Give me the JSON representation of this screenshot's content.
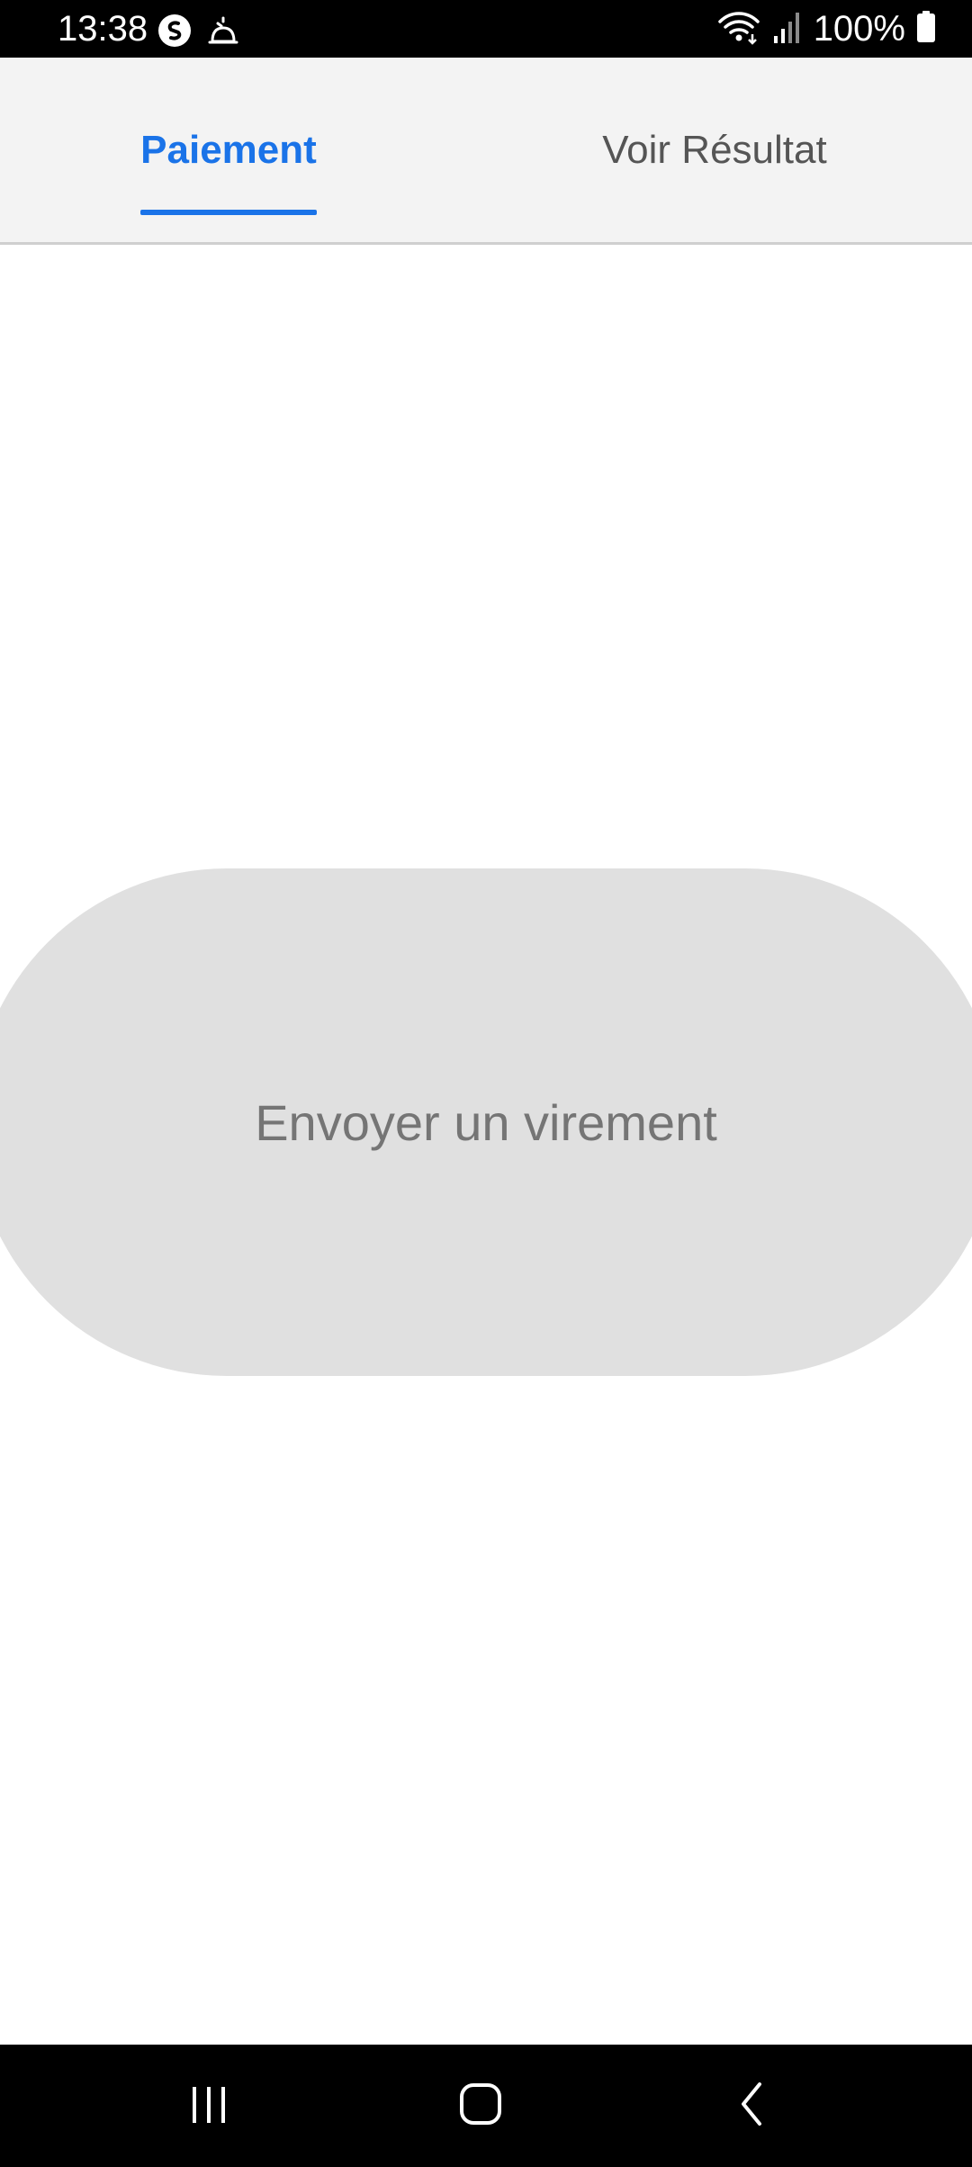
{
  "status_bar": {
    "time": "13:38",
    "battery_percent": "100%",
    "left_icons": [
      "shazam-icon",
      "notification-bell-icon"
    ],
    "right_icons": [
      "wifi-icon",
      "signal-icon",
      "battery-icon"
    ]
  },
  "tabs": [
    {
      "label": "Paiement",
      "selected": true
    },
    {
      "label": "Voir Résultat",
      "selected": false
    }
  ],
  "main": {
    "primary_button_label": "Envoyer un virement"
  },
  "navigation_bar": {
    "buttons": [
      "recents-icon",
      "home-icon",
      "back-icon"
    ]
  },
  "colors": {
    "accent": "#1a73e8",
    "tab_bar_background": "#f3f3f3",
    "button_background": "#e0e0e0",
    "button_text": "#757575",
    "system_bars": "#000000"
  }
}
